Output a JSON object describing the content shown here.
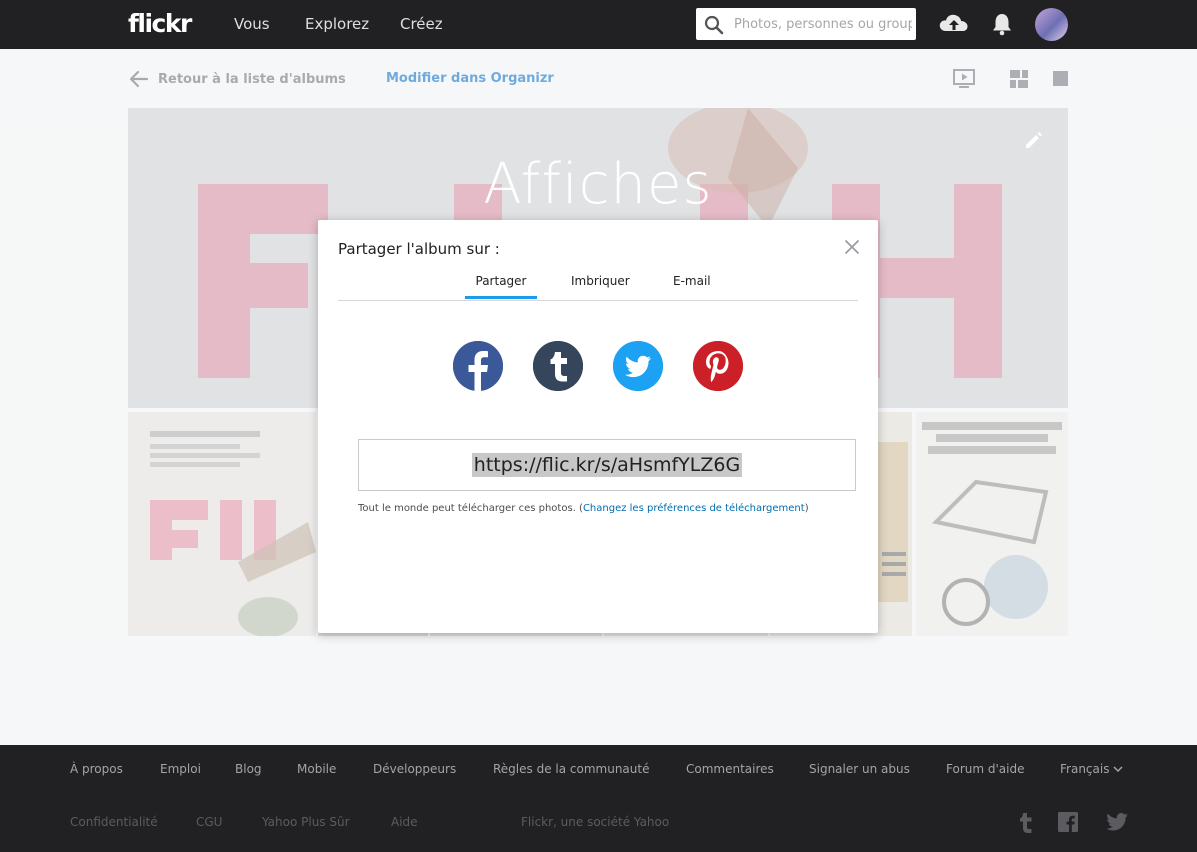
{
  "nav": {
    "logo": "flickr",
    "links": [
      "Vous",
      "Explorez",
      "Créez"
    ],
    "search_placeholder": "Photos, personnes ou groupes"
  },
  "subnav": {
    "back_label": "Retour à la liste d'albums",
    "organizr_label": "Modifier dans Organizr"
  },
  "album": {
    "title": "Affiches"
  },
  "modal": {
    "title": "Partager l'album sur :",
    "tabs": [
      "Partager",
      "Imbriquer",
      "E-mail"
    ],
    "active_tab": "Partager",
    "social": [
      "facebook-icon",
      "tumblr-icon",
      "twitter-icon",
      "pinterest-icon"
    ],
    "share_url": "https://flic.kr/s/aHsmfYLZ6G",
    "download_note": "Tout le monde peut télécharger ces photos. (",
    "download_link": "Changez les préférences de téléchargement",
    "download_close": ")"
  },
  "footer": {
    "links": [
      "À propos",
      "Emploi",
      "Blog",
      "Mobile",
      "Développeurs",
      "Règles de la communauté",
      "Commentaires",
      "Signaler un abus",
      "Forum d'aide"
    ],
    "language": "Français",
    "links2": [
      "Confidentialité",
      "CGU",
      "Yahoo Plus Sûr",
      "Aide"
    ],
    "company": "Flickr, une société Yahoo"
  },
  "colors": {
    "nav_bg": "#212124",
    "accent": "#1c9be9",
    "link": "#006dac",
    "facebook": "#3b5998",
    "tumblr": "#35465c",
    "twitter": "#1da1f2",
    "pinterest": "#cb2027"
  }
}
